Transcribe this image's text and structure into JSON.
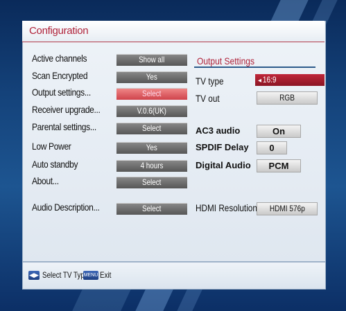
{
  "window": {
    "title": "Configuration"
  },
  "settings": [
    {
      "label": "Active channels",
      "value": "Show all"
    },
    {
      "label": "Scan Encrypted",
      "value": "Yes"
    },
    {
      "label": "Output settings...",
      "value": "Select",
      "selected": true
    },
    {
      "label": "Receiver upgrade...",
      "value": "V.0.6(UK)"
    },
    {
      "label": "Parental settings...",
      "value": "Select"
    },
    {
      "label": "Low Power",
      "value": "Yes"
    },
    {
      "label": "Auto standby",
      "value": "4 hours"
    },
    {
      "label": "About...",
      "value": "Select"
    },
    {
      "label": "Audio Description...",
      "value": "Select"
    }
  ],
  "output_settings": {
    "heading": "Output Settings",
    "tv_type": {
      "label": "TV type",
      "value": "16:9",
      "arrow": "◂"
    },
    "tv_out": {
      "label": "TV out",
      "value": "RGB"
    },
    "ac3_audio": {
      "label": "AC3 audio",
      "value": "On"
    },
    "spdif_delay": {
      "label": "SPDIF Delay",
      "value": "0"
    },
    "digital_audio": {
      "label": "Digital Audio",
      "value": "PCM"
    },
    "hdmi_resolution": {
      "label": "HDMI Resolution",
      "value": "HDMI 576p"
    }
  },
  "footer": {
    "arrows_key": "◀▶",
    "arrows_hint": "Select TV Type",
    "menu_key": "MENU",
    "menu_hint": "Exit"
  },
  "colors": {
    "accent_red": "#b0233a",
    "selection_red": "#d0434b",
    "background_blue": "#14427a"
  }
}
